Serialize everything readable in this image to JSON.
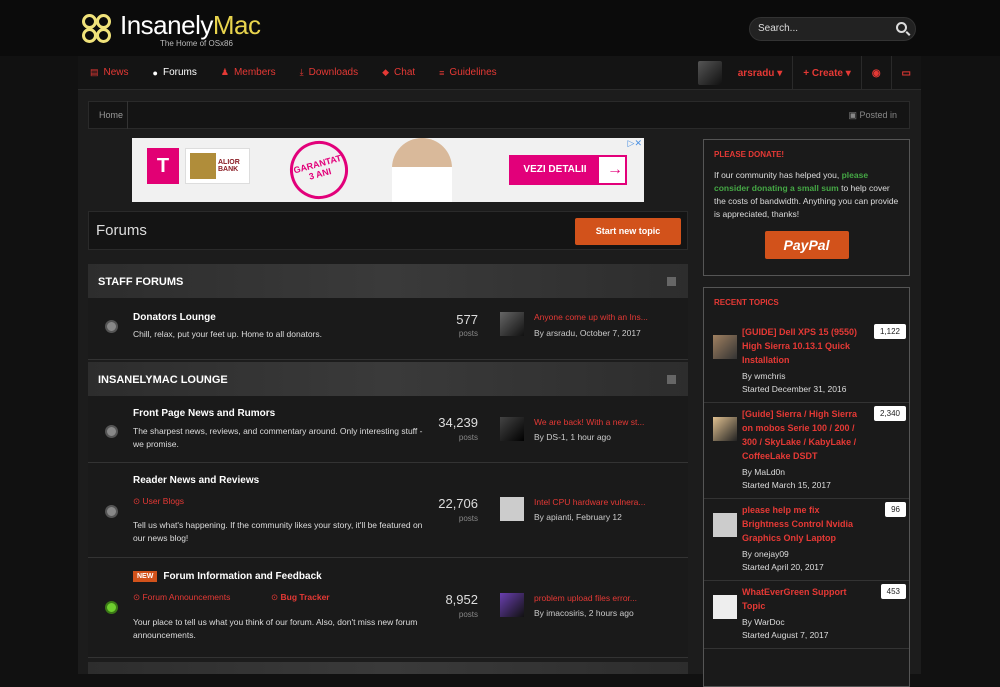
{
  "brand": {
    "title_a": "Insanely",
    "title_b": "Mac",
    "subtitle": "The Home of OSx86"
  },
  "search": {
    "placeholder": "Search..."
  },
  "nav": {
    "items": [
      {
        "label": "News",
        "icon": "newspaper-icon"
      },
      {
        "label": "Forums",
        "icon": "comments-icon"
      },
      {
        "label": "Members",
        "icon": "users-icon"
      },
      {
        "label": "Downloads",
        "icon": "download-icon"
      },
      {
        "label": "Chat",
        "icon": "chat-icon"
      },
      {
        "label": "Guidelines",
        "icon": "list-icon"
      }
    ],
    "user": "arsradu",
    "create": "Create"
  },
  "breadcrumb": {
    "home": "Home",
    "posted_in": "Posted in"
  },
  "ad": {
    "brand_t": "T",
    "alior": "ALIOR BANK",
    "guarantee": "GARANTAT 3 ANI",
    "cta": "VEZI DETALII"
  },
  "page": {
    "title": "Forums",
    "start_topic": "Start new topic"
  },
  "categories": [
    {
      "title": "STAFF FORUMS"
    },
    {
      "title": "INSANELYMAC LOUNGE"
    }
  ],
  "forums": [
    {
      "title": "Donators Lounge",
      "desc": "Chill, relax, put your feet up. Home to all donators.",
      "count": "577",
      "count_label": "posts",
      "last_title": "Anyone come up with an Ins...",
      "last_meta": "By arsradu, October 7, 2017"
    },
    {
      "title": "Front Page News and Rumors",
      "desc": "The sharpest news, reviews, and commentary around. Only interesting stuff - we promise.",
      "count": "34,239",
      "count_label": "posts",
      "last_title": "We are back! With a new st...",
      "last_meta": "By DS-1, 1 hour ago"
    },
    {
      "title": "Reader News and Reviews",
      "sub": "User Blogs",
      "desc": "Tell us what's happening. If the community likes your story, it'll be featured on our news blog!",
      "count": "22,706",
      "count_label": "posts",
      "last_title": "Intel CPU hardware vulnera...",
      "last_meta": "By apianti, February 12"
    },
    {
      "title": "Forum Information and Feedback",
      "badge": "NEW",
      "sub1": "Forum Announcements",
      "sub2": "Bug Tracker",
      "desc": "Your place to tell us what you think of our forum. Also, don't miss new forum announcements.",
      "count": "8,952",
      "count_label": "posts",
      "last_title": "problem upload files error...",
      "last_meta": "By imacosiris, 2 hours ago"
    }
  ],
  "donate": {
    "title": "PLEASE DONATE!",
    "text1": "If our community has helped you,",
    "link": "please consider donating a small sum",
    "text2": "to help cover the costs of bandwidth. Anything you can provide is appreciated, thanks!",
    "button": "PayPal"
  },
  "recent": {
    "title": "RECENT TOPICS",
    "items": [
      {
        "title": "[GUIDE] Dell XPS 15 (9550) High Sierra 10.13.1 Quick Installation",
        "by": "By wmchris",
        "date": "Started December 31, 2016",
        "count": "1,122"
      },
      {
        "title": "[Guide] Sierra / High Sierra on mobos Serie 100 / 200 / 300 / SkyLake / KabyLake / CoffeeLake DSDT",
        "by": "By MaLd0n",
        "date": "Started March 15, 2017",
        "count": "2,340"
      },
      {
        "title": "please help me fix Brightness Control Nvidia Graphics Only Laptop",
        "by": "By onejay09",
        "date": "Started April 20, 2017",
        "count": "96"
      },
      {
        "title": "WhatEverGreen Support Topic",
        "by": "By WarDoc",
        "date": "Started August 7, 2017",
        "count": "453"
      }
    ]
  }
}
